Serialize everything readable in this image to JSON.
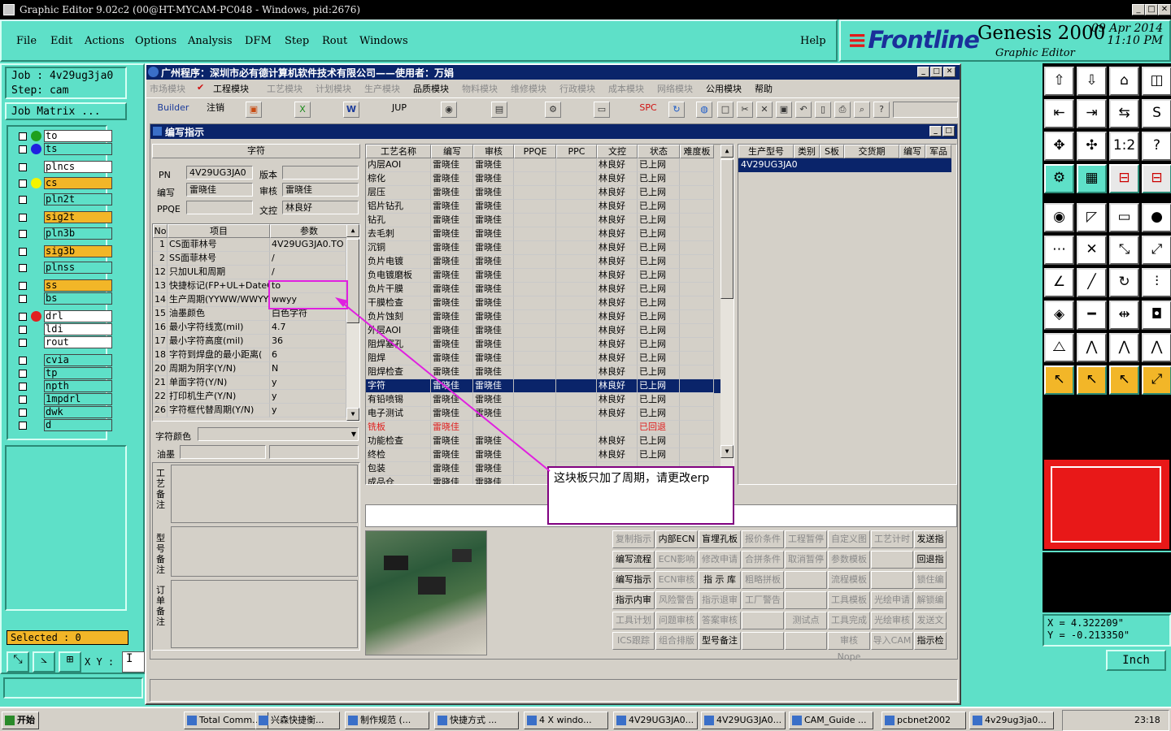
{
  "app": {
    "title": "Graphic Editor 9.02c2 (00@HT-MYCAM-PC048 - Windows, pid:2676)"
  },
  "menu": [
    "File",
    "Edit",
    "Actions",
    "Options",
    "Analysis",
    "DFM",
    "Step",
    "Rout",
    "Windows"
  ],
  "help_label": "Help",
  "brand": {
    "logo": "Frontline",
    "product": "Genesis 2000",
    "subtitle": "Graphic Editor",
    "date": "09 Apr 2014",
    "time": "11:10 PM"
  },
  "job": {
    "job_line": "Job : 4v29ug3ja0",
    "step_line": "Step: cam",
    "matrix_button": "Job Matrix ..."
  },
  "layers": [
    {
      "name": "to",
      "style": "wh",
      "dot": "#1fa01f"
    },
    {
      "name": "ts",
      "style": "cy",
      "dot": "#2020e0"
    },
    {
      "name": "plncs",
      "style": "wh",
      "dot": ""
    },
    {
      "name": "cs",
      "style": "sig",
      "dot": "#f4f400"
    },
    {
      "name": "pln2t",
      "style": "cy",
      "dot": ""
    },
    {
      "name": "sig2t",
      "style": "sig",
      "dot": ""
    },
    {
      "name": "pln3b",
      "style": "cy",
      "dot": ""
    },
    {
      "name": "sig3b",
      "style": "sig",
      "dot": ""
    },
    {
      "name": "plnss",
      "style": "cy",
      "dot": ""
    },
    {
      "name": "ss",
      "style": "sig",
      "dot": ""
    },
    {
      "name": "bs",
      "style": "cy",
      "dot": ""
    },
    {
      "name": "drl",
      "style": "wh",
      "dot": "#e02020"
    },
    {
      "name": "ldi",
      "style": "wh",
      "dot": ""
    },
    {
      "name": "rout",
      "style": "wh",
      "dot": ""
    },
    {
      "name": "cvia",
      "style": "cy",
      "dot": ""
    },
    {
      "name": "tp",
      "style": "cy",
      "dot": ""
    },
    {
      "name": "npth",
      "style": "cy",
      "dot": ""
    },
    {
      "name": "1mpdrl",
      "style": "cy",
      "dot": ""
    },
    {
      "name": "dwk",
      "style": "cy",
      "dot": ""
    },
    {
      "name": "d",
      "style": "cy",
      "dot": ""
    }
  ],
  "selected_label": "Selected : 0",
  "xy_label": "X Y :",
  "erp": {
    "title": "广州程序：深圳市必有德计算机软件技术有限公司——使用者：万娟",
    "modules": [
      {
        "label": "市场模块",
        "on": false
      },
      {
        "label": "工程模块",
        "on": true
      },
      {
        "label": "工艺模块",
        "on": false
      },
      {
        "label": "计划模块",
        "on": false
      },
      {
        "label": "生产模块",
        "on": false
      },
      {
        "label": "品质模块",
        "on": true
      },
      {
        "label": "物料模块",
        "on": false
      },
      {
        "label": "维修模块",
        "on": false
      },
      {
        "label": "行政模块",
        "on": false
      },
      {
        "label": "成本模块",
        "on": false
      },
      {
        "label": "网络模块",
        "on": false
      },
      {
        "label": "公用模块",
        "on": true
      },
      {
        "label": "帮助",
        "on": true
      }
    ],
    "toolbar": {
      "builder": "Builder",
      "logout": "注销",
      "jup": "JUP",
      "spc": "SPC"
    },
    "subwindow_title": "编写指示",
    "header_section": "字符",
    "pn_label": "PN",
    "pn_value": "4V29UG3JA0",
    "version_label": "版本",
    "version_value": "",
    "author_label": "编写",
    "author_value": "雷晓佳",
    "review_label": "审核",
    "review_value": "雷晓佳",
    "ppqe_label": "PPQE",
    "ppqe_value": "",
    "control_label": "文控",
    "control_value": "林良好",
    "params_head": {
      "no": "No",
      "item": "项目",
      "param": "参数"
    },
    "params": [
      {
        "no": "1",
        "item": "CS面菲林号",
        "param": "4V29UG3JA0.TO"
      },
      {
        "no": "2",
        "item": "SS面菲林号",
        "param": "/"
      },
      {
        "no": "12",
        "item": "只加UL和周期",
        "param": "/"
      },
      {
        "no": "13",
        "item": "快捷标记(FP+UL+DateC",
        "param": "to"
      },
      {
        "no": "14",
        "item": "生产周期(YYWW/WWYY)",
        "param": "wwyy"
      },
      {
        "no": "15",
        "item": "油墨颜色",
        "param": "白色字符"
      },
      {
        "no": "16",
        "item": "最小字符线宽(mil)",
        "param": "4.7"
      },
      {
        "no": "17",
        "item": "最小字符高度(mil)",
        "param": "36"
      },
      {
        "no": "18",
        "item": "字符到焊盘的最小距离(",
        "param": "6"
      },
      {
        "no": "20",
        "item": "周期为阴字(Y/N)",
        "param": "N"
      },
      {
        "no": "21",
        "item": "单面字符(Y/N)",
        "param": "y"
      },
      {
        "no": "22",
        "item": "打印机生产(Y/N)",
        "param": "y"
      },
      {
        "no": "26",
        "item": "字符框代替周期(Y/N)",
        "param": "y"
      }
    ],
    "char_color_label": "字符颜色",
    "ink_label": "油墨",
    "note1_label": "工艺备注",
    "note2_label": "型号备注",
    "note3_label": "订单备注",
    "process_head": [
      "工艺名称",
      "编写",
      "审核",
      "PPQE",
      "PPC",
      "文控",
      "状态",
      "难度板"
    ],
    "process": [
      {
        "name": "内层AOI",
        "w": "雷晓佳",
        "r": "雷晓佳",
        "c": "林良好",
        "s": "已上网"
      },
      {
        "name": "棕化",
        "w": "雷晓佳",
        "r": "雷晓佳",
        "c": "林良好",
        "s": "已上网"
      },
      {
        "name": "层压",
        "w": "雷晓佳",
        "r": "雷晓佳",
        "c": "林良好",
        "s": "已上网"
      },
      {
        "name": "铝片钻孔",
        "w": "雷晓佳",
        "r": "雷晓佳",
        "c": "林良好",
        "s": "已上网"
      },
      {
        "name": "钻孔",
        "w": "雷晓佳",
        "r": "雷晓佳",
        "c": "林良好",
        "s": "已上网"
      },
      {
        "name": "去毛刺",
        "w": "雷晓佳",
        "r": "雷晓佳",
        "c": "林良好",
        "s": "已上网"
      },
      {
        "name": "沉铜",
        "w": "雷晓佳",
        "r": "雷晓佳",
        "c": "林良好",
        "s": "已上网"
      },
      {
        "name": "负片电镀",
        "w": "雷晓佳",
        "r": "雷晓佳",
        "c": "林良好",
        "s": "已上网"
      },
      {
        "name": "负电镀磨板",
        "w": "雷晓佳",
        "r": "雷晓佳",
        "c": "林良好",
        "s": "已上网"
      },
      {
        "name": "负片干膜",
        "w": "雷晓佳",
        "r": "雷晓佳",
        "c": "林良好",
        "s": "已上网"
      },
      {
        "name": "干膜检查",
        "w": "雷晓佳",
        "r": "雷晓佳",
        "c": "林良好",
        "s": "已上网"
      },
      {
        "name": "负片蚀刻",
        "w": "雷晓佳",
        "r": "雷晓佳",
        "c": "林良好",
        "s": "已上网"
      },
      {
        "name": "外层AOI",
        "w": "雷晓佳",
        "r": "雷晓佳",
        "c": "林良好",
        "s": "已上网"
      },
      {
        "name": "阻焊塞孔",
        "w": "雷晓佳",
        "r": "雷晓佳",
        "c": "林良好",
        "s": "已上网"
      },
      {
        "name": "阻焊",
        "w": "雷晓佳",
        "r": "雷晓佳",
        "c": "林良好",
        "s": "已上网"
      },
      {
        "name": "阻焊检查",
        "w": "雷晓佳",
        "r": "雷晓佳",
        "c": "林良好",
        "s": "已上网"
      },
      {
        "name": "字符",
        "w": "雷晓佳",
        "r": "雷晓佳",
        "c": "林良好",
        "s": "已上网",
        "sel": true
      },
      {
        "name": "有铅喷锡",
        "w": "雷晓佳",
        "r": "雷晓佳",
        "c": "林良好",
        "s": "已上网"
      },
      {
        "name": "电子测试",
        "w": "雷晓佳",
        "r": "雷晓佳",
        "c": "林良好",
        "s": "已上网"
      },
      {
        "name": "铣板",
        "w": "雷晓佳",
        "r": "",
        "c": "",
        "s": "已回退",
        "red": true
      },
      {
        "name": "功能检查",
        "w": "雷晓佳",
        "r": "雷晓佳",
        "c": "林良好",
        "s": "已上网"
      },
      {
        "name": "终检",
        "w": "雷晓佳",
        "r": "雷晓佳",
        "c": "林良好",
        "s": "已上网"
      },
      {
        "name": "包装",
        "w": "雷晓佳",
        "r": "雷晓佳",
        "c": "",
        "s": ""
      },
      {
        "name": "成品仓",
        "w": "雷晓佳",
        "r": "雷晓佳",
        "c": "",
        "s": ""
      }
    ],
    "model_head": [
      "生产型号",
      "类别",
      "S板",
      "交货期",
      "编写",
      "军品"
    ],
    "model_row": {
      "pn": "4V29UG3JA0"
    },
    "annotation": "这块板只加了周期，请更改erp",
    "actions": [
      [
        {
          "l": "复制指示",
          "on": false
        },
        {
          "l": "内部ECN",
          "on": true
        },
        {
          "l": "盲埋孔板",
          "on": true
        },
        {
          "l": "报价条件",
          "on": false
        },
        {
          "l": "工程暂停",
          "on": false
        },
        {
          "l": "自定义图",
          "on": false
        },
        {
          "l": "工艺计时",
          "on": false
        },
        {
          "l": "发送指",
          "on": true
        }
      ],
      [
        {
          "l": "编写流程",
          "on": true
        },
        {
          "l": "ECN影响",
          "on": false
        },
        {
          "l": "修改申请",
          "on": false
        },
        {
          "l": "合拼条件",
          "on": false
        },
        {
          "l": "取消暂停",
          "on": false
        },
        {
          "l": "参数模板",
          "on": false
        },
        {
          "l": "",
          "on": false
        },
        {
          "l": "回退指",
          "on": true
        }
      ],
      [
        {
          "l": "编写指示",
          "on": true
        },
        {
          "l": "ECN审核",
          "on": false
        },
        {
          "l": "指 示 库",
          "on": true
        },
        {
          "l": "粗略拼板",
          "on": false
        },
        {
          "l": "",
          "on": false
        },
        {
          "l": "流程模板",
          "on": false
        },
        {
          "l": "",
          "on": false
        },
        {
          "l": "锁住编",
          "on": false
        }
      ],
      [
        {
          "l": "指示内审",
          "on": true
        },
        {
          "l": "风险警告",
          "on": false
        },
        {
          "l": "指示退审",
          "on": false
        },
        {
          "l": "工厂警告",
          "on": false
        },
        {
          "l": "",
          "on": false
        },
        {
          "l": "工具模板",
          "on": false
        },
        {
          "l": "光绘申请",
          "on": false
        },
        {
          "l": "解锁编",
          "on": false
        }
      ],
      [
        {
          "l": "工具计划",
          "on": false
        },
        {
          "l": "问题审核",
          "on": false
        },
        {
          "l": "答案审核",
          "on": false
        },
        {
          "l": "",
          "on": false
        },
        {
          "l": "测试点",
          "on": false
        },
        {
          "l": "工具完成",
          "on": false
        },
        {
          "l": "光绘审核",
          "on": false
        },
        {
          "l": "发送文",
          "on": false
        }
      ],
      [
        {
          "l": "ICS跟踪",
          "on": false
        },
        {
          "l": "组合排版",
          "on": false
        },
        {
          "l": "型号备注",
          "on": true
        },
        {
          "l": "",
          "on": false
        },
        {
          "l": "",
          "on": false
        },
        {
          "l": "审核Nope",
          "on": false
        },
        {
          "l": "导入CAM",
          "on": false
        },
        {
          "l": "指示检",
          "on": true
        }
      ]
    ]
  },
  "right_tools": [
    "⇧",
    "⇩",
    "⌂",
    "◫",
    "⇤",
    "⇥",
    "⇆",
    "S",
    "✥",
    "✣",
    "1:2",
    "?",
    "⚙",
    "▦",
    "⊟",
    "⊟",
    "◉",
    "◸",
    "▭",
    "●",
    "⋯",
    "✕",
    "⤡",
    "⤢",
    "∠",
    "╱",
    "↻",
    "⫶",
    "◈",
    "━",
    "⇹",
    "◘",
    "⧍",
    "⋀",
    "⋀",
    "⋀",
    "↖",
    "↖",
    "↖",
    "⤢"
  ],
  "coords": {
    "x": "X = 4.322209\"",
    "y": "Y = -0.213350\""
  },
  "unit": "Inch",
  "taskbar": {
    "start": "开始",
    "tasks": [
      "Total Comm...",
      "兴森快捷衡...",
      "制作规范 (...",
      "快捷方式 ...",
      "4 X windo...",
      "4V29UG3JA0...",
      "4V29UG3JA0...",
      "CAM_Guide ...",
      "pcbnet2002",
      "4v29ug3ja0..."
    ],
    "clock": "23:18"
  }
}
